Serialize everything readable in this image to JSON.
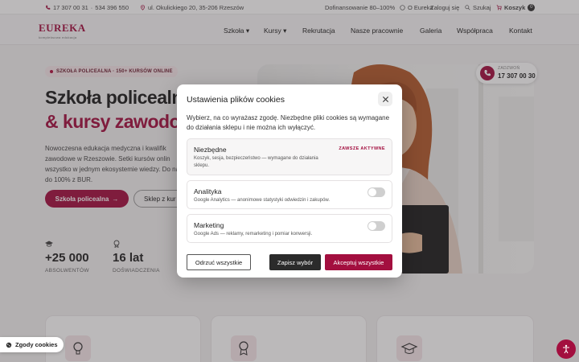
{
  "topbar": {
    "phone1": "17 307 00 31",
    "separator": "·",
    "phone2": "534 396 550",
    "address": "ul. Okulickiego 20, 35-206 Rzeszów",
    "funding": "Dofinansowanie 80–100%",
    "about": "O Eureka",
    "login": "Zaloguj się",
    "search": "Szukaj",
    "cart": "Koszyk",
    "cart_count": "0"
  },
  "brand": {
    "name": "EUREKA",
    "tagline": "kompleksowa edukacja"
  },
  "nav": {
    "items": [
      "Szkoła",
      "Kursy",
      "Rekrutacja",
      "Nasze pracownie",
      "Galeria",
      "Współpraca",
      "Kontakt"
    ]
  },
  "hero": {
    "pill": "SZKOŁA POLICEALNA · 150+ KURSÓW ONLINE",
    "title_line1": "Szkoła policealn",
    "title_line2": "& kursy zawodo",
    "description": "Nowoczesna edukacja medyczna i kwalifik zawodowe w Rzeszowie. Setki kursów onlin wszystko w jednym ekosystemie wiedzy. Do nawet do 100% z BUR.",
    "btn_primary": "Szkoła policealna",
    "btn_secondary": "Sklep z kur",
    "stats": [
      {
        "value": "+25 000",
        "label": "ABSOLWENTÓW"
      },
      {
        "value": "16 lat",
        "label": "DOŚWIADCZENIA"
      }
    ],
    "call_label": "ZADZWOŃ",
    "call_number": "17 307 00 30"
  },
  "cookie_modal": {
    "title": "Ustawienia plików cookies",
    "description": "Wybierz, na co wyrażasz zgodę. Niezbędne pliki cookies są wymagane do działania sklepu i nie można ich wyłączyć.",
    "options": [
      {
        "name": "Niezbędne",
        "desc": "Koszyk, sesja, bezpieczeństwo — wymagane do działania sklepu.",
        "status": "ZAWSZE AKTYWNE"
      },
      {
        "name": "Analityka",
        "desc": "Google Analytics — anonimowe statystyki odwiedzin i zakupów.",
        "enabled": false
      },
      {
        "name": "Marketing",
        "desc": "Google Ads — reklamy, remarketing i pomiar konwersji.",
        "enabled": false
      }
    ],
    "btn_reject": "Odrzuć wszystkie",
    "btn_save": "Zapisz wybór",
    "btn_accept": "Akceptuj wszystkie"
  },
  "cookie_chip": "Zgody cookies",
  "colors": {
    "brand": "#a30f3f",
    "dark": "#2b2b2b"
  }
}
